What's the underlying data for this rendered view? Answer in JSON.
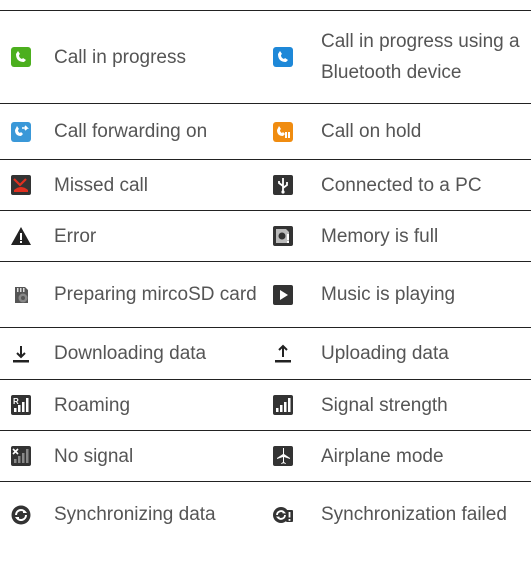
{
  "rows": [
    {
      "left": {
        "icon": "call-in-progress-icon",
        "label": "Call in progress"
      },
      "right": {
        "icon": "bluetooth-call-icon",
        "label": "Call in progress using a Bluetooth device"
      }
    },
    {
      "left": {
        "icon": "call-forwarding-icon",
        "label": "Call forwarding on"
      },
      "right": {
        "icon": "call-on-hold-icon",
        "label": "Call on hold"
      }
    },
    {
      "left": {
        "icon": "missed-call-icon",
        "label": "Missed call"
      },
      "right": {
        "icon": "usb-connected-icon",
        "label": "Connected to a PC"
      }
    },
    {
      "left": {
        "icon": "error-icon",
        "label": "Error"
      },
      "right": {
        "icon": "memory-full-icon",
        "label": "Memory is full"
      }
    },
    {
      "left": {
        "icon": "sd-card-preparing-icon",
        "label": "Preparing mircoSD card"
      },
      "right": {
        "icon": "music-playing-icon",
        "label": "Music is playing"
      }
    },
    {
      "left": {
        "icon": "download-icon",
        "label": "Downloading data"
      },
      "right": {
        "icon": "upload-icon",
        "label": "Uploading data"
      }
    },
    {
      "left": {
        "icon": "roaming-icon",
        "label": "Roaming"
      },
      "right": {
        "icon": "signal-strength-icon",
        "label": "Signal strength"
      }
    },
    {
      "left": {
        "icon": "no-signal-icon",
        "label": "No signal"
      },
      "right": {
        "icon": "airplane-mode-icon",
        "label": "Airplane mode"
      }
    },
    {
      "left": {
        "icon": "sync-icon",
        "label": "Synchronizing data"
      },
      "right": {
        "icon": "sync-failed-icon",
        "label": "Synchronization failed"
      }
    }
  ],
  "colors": {
    "green": "#4caf1e",
    "blue": "#1e88d8",
    "orange": "#f08c10",
    "red": "#d83020",
    "dark": "#333333",
    "border": "#222222",
    "text": "#555555"
  }
}
